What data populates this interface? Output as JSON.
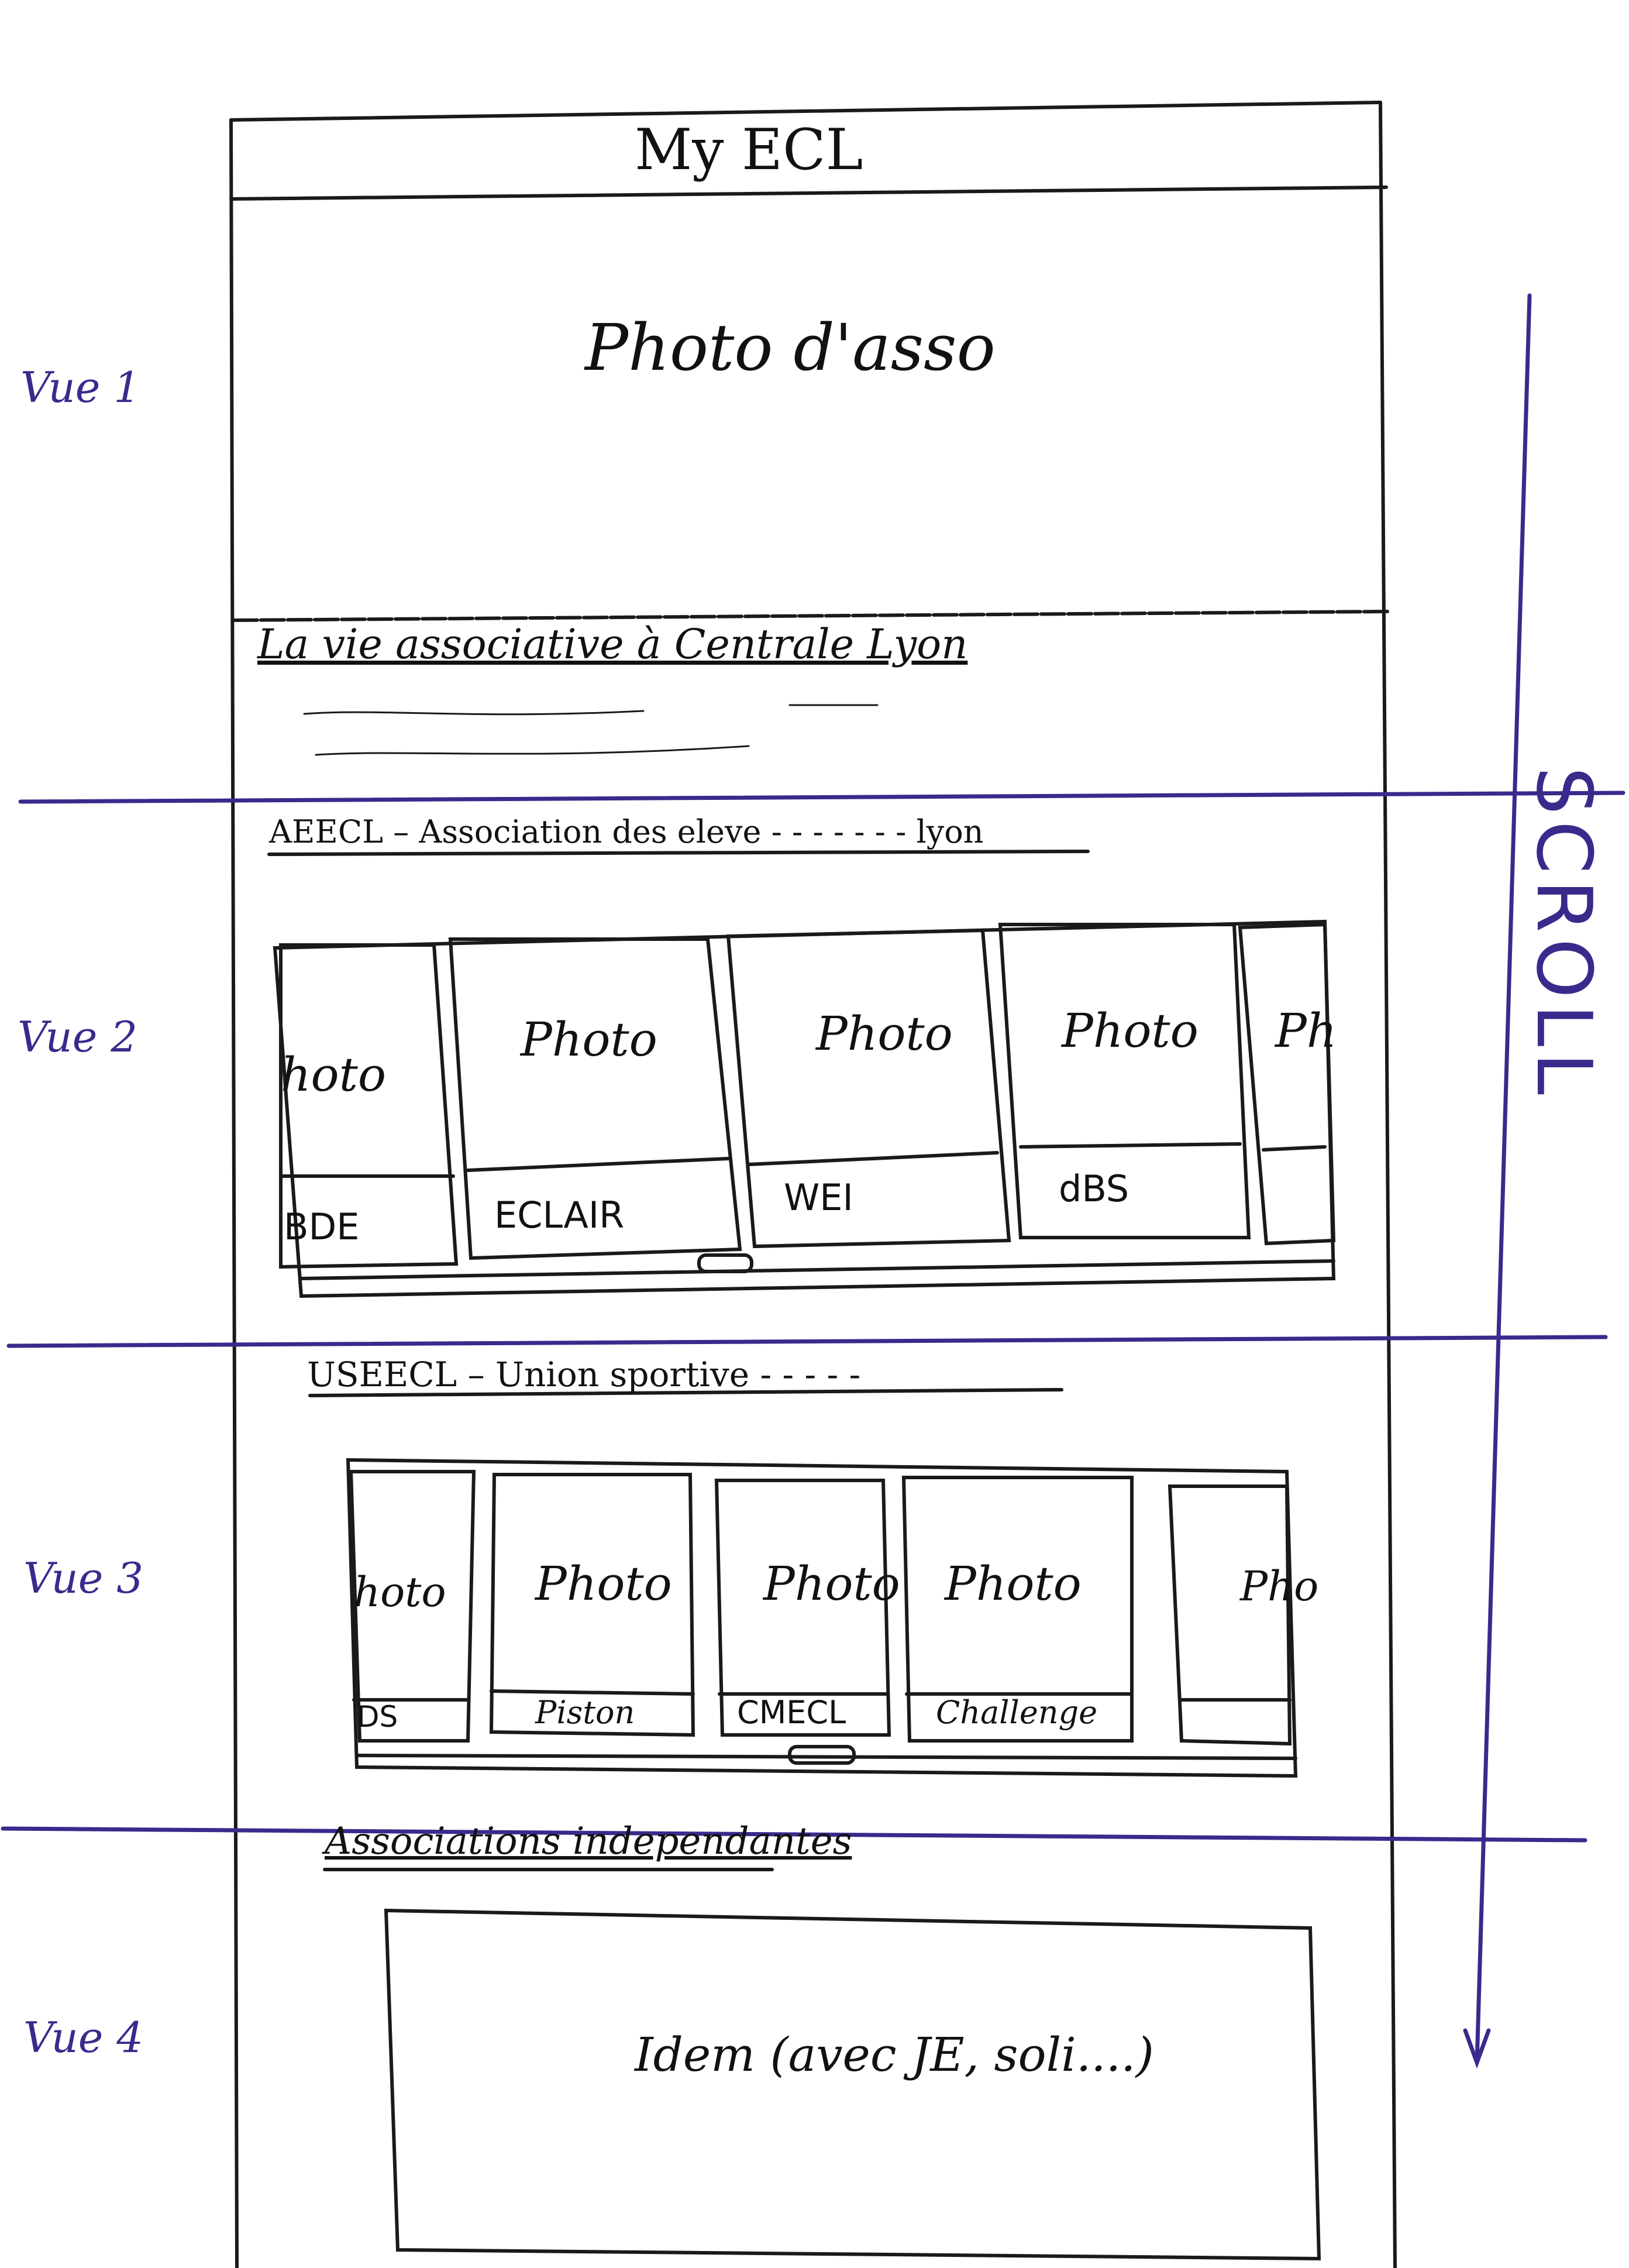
{
  "app_title": "My ECL",
  "hero": {
    "label": "Photo d'asso"
  },
  "intro": {
    "title": "La vie associative à Centrale Lyon"
  },
  "section_aeecl": {
    "title": "AEECL – Association des eleve - - - - - - - lyon",
    "cards": [
      {
        "photo": "hoto",
        "label": "BDE"
      },
      {
        "photo": "Photo",
        "label": "ECLAIR"
      },
      {
        "photo": "Photo",
        "label": "WEI"
      },
      {
        "photo": "Photo",
        "label": "dBS"
      },
      {
        "photo": "Ph",
        "label": ""
      }
    ]
  },
  "section_useecl": {
    "title": "USEECL – Union sportive - - - - -",
    "cards": [
      {
        "photo": "hoto",
        "label": "DS"
      },
      {
        "photo": "Photo",
        "label": "Piston"
      },
      {
        "photo": "Photo",
        "label": "CMECL"
      },
      {
        "photo": "Photo",
        "label": "Challenge"
      },
      {
        "photo": "Pho",
        "label": ""
      }
    ]
  },
  "section_independent": {
    "title": "Associations independantes",
    "placeholder": "Idem (avec JE, soli....)"
  },
  "views": [
    "Vue 1",
    "Vue 2",
    "Vue 3",
    "Vue 4"
  ],
  "scroll_label": "SCROLL",
  "colors": {
    "ink": "#1a1a1a",
    "annotation": "#3a2a8c"
  }
}
